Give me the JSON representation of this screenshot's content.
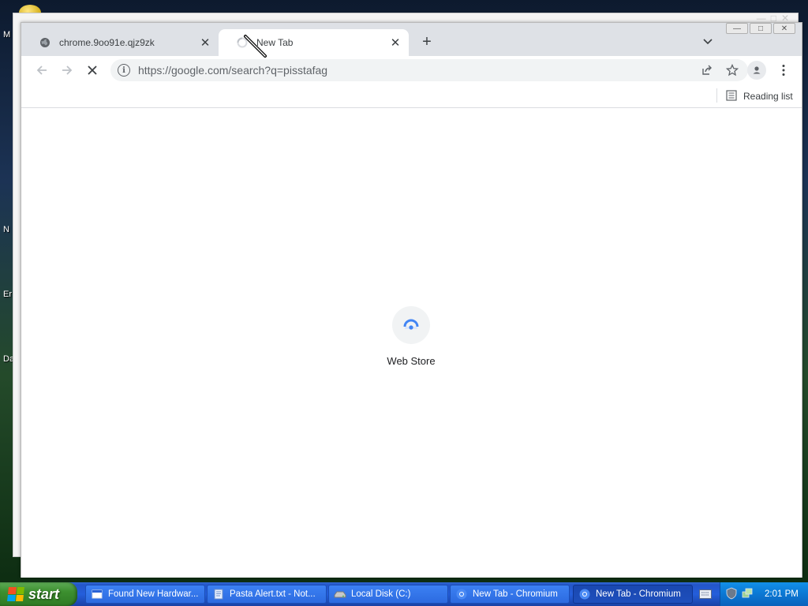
{
  "desktop": {
    "icon_labels": [
      "M",
      "N",
      "Er",
      "Da"
    ]
  },
  "browser": {
    "tabs": [
      {
        "title": "chrome.9oo91e.qjz9zk",
        "icon": "globe-icon",
        "active": false
      },
      {
        "title": "New Tab",
        "icon": "loading-spinner-icon",
        "active": true
      }
    ],
    "window_controls": [
      "minimize",
      "maximize",
      "close"
    ],
    "toolbar": {
      "back_icon": "arrow-left-icon",
      "forward_icon": "arrow-right-icon",
      "stop_icon": "close-icon",
      "url": "https://google.com/search?q=pisstafag",
      "share_icon": "share-icon",
      "bookmark_icon": "star-icon",
      "profile_icon": "person-icon",
      "menu_icon": "kebab-menu-icon"
    },
    "bookmarks_bar": {
      "reading_list_label": "Reading list"
    },
    "content": {
      "shortcut_tiles": [
        {
          "label": "Web Store",
          "icon": "web-store-icon"
        }
      ]
    }
  },
  "taskbar": {
    "start_label": "start",
    "tasks": [
      {
        "label": "Found New Hardwar...",
        "icon": "window-icon",
        "active": false
      },
      {
        "label": "Pasta Alert.txt - Not...",
        "icon": "notepad-icon",
        "active": false
      },
      {
        "label": "Local Disk (C:)",
        "icon": "drive-icon",
        "active": false
      },
      {
        "label": "New Tab - Chromium",
        "icon": "chromium-icon",
        "active": false
      },
      {
        "label": "New Tab - Chromium",
        "icon": "chromium-icon",
        "active": true
      }
    ],
    "clock": "2:01 PM"
  },
  "colors": {
    "tabstrip_bg": "#dee1e6",
    "omnibox_bg": "#f1f3f4",
    "taskbar_blue": "#245edb",
    "start_green": "#3c8f2f",
    "tray_blue": "#0b77d3"
  }
}
